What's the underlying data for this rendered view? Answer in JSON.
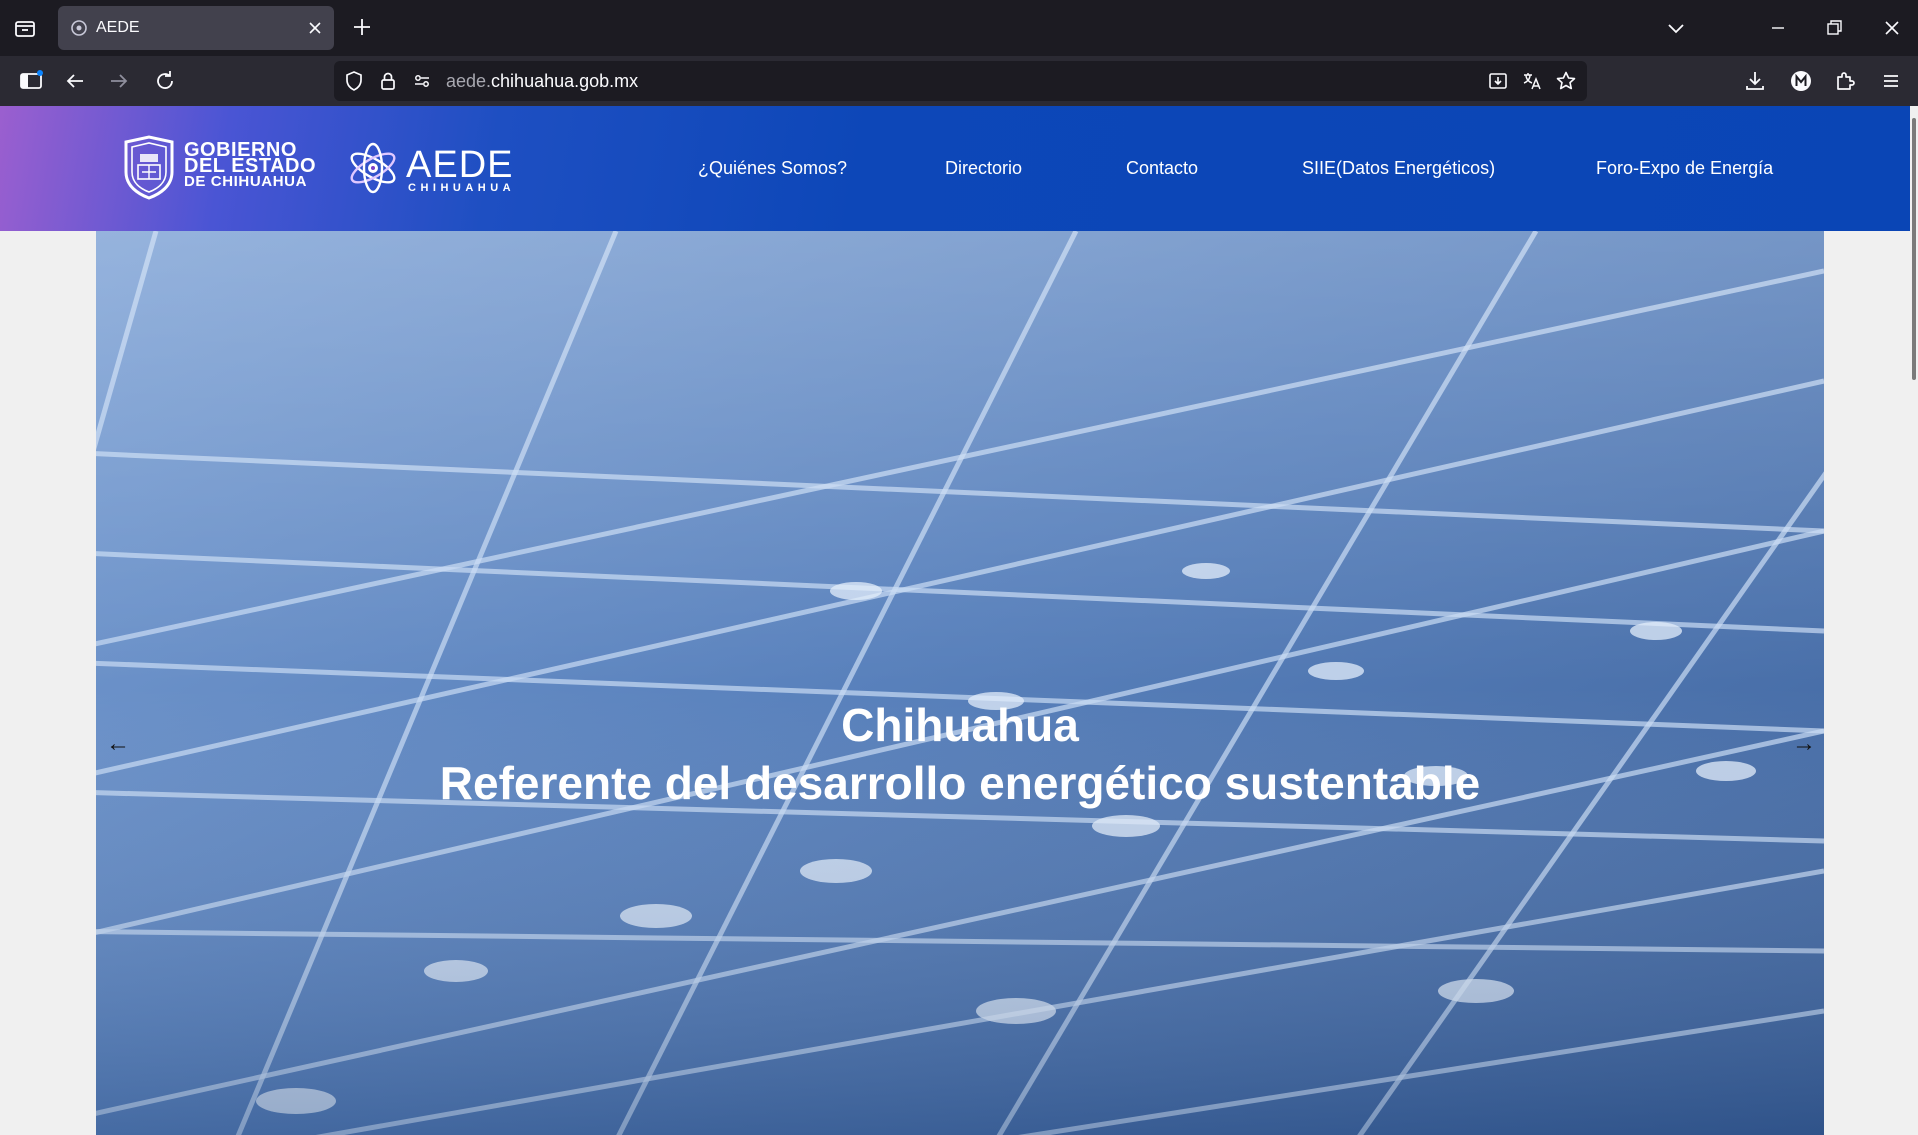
{
  "browser": {
    "tab_title": "AEDE",
    "url_domain_prefix": "aede.",
    "url_domain_main": "chihuahua.gob.mx"
  },
  "site": {
    "gov_logo": {
      "line1": "GOBIERNO",
      "line2": "DEL ESTADO",
      "line3": "DE CHIHUAHUA"
    },
    "aede_logo": {
      "word": "AEDE",
      "sub": "CHIHUAHUA"
    },
    "nav": [
      {
        "label": "¿Quiénes Somos?"
      },
      {
        "label": "Directorio"
      },
      {
        "label": "Contacto"
      },
      {
        "label": "SIIE(Datos Energéticos)"
      },
      {
        "label": "Foro-Expo de Energía"
      }
    ]
  },
  "hero": {
    "title": "Chihuahua",
    "subtitle": "Referente del desarrollo energético sustentable",
    "prev_arrow": "←",
    "next_arrow": "→"
  },
  "colors": {
    "header_gradient_start": "#9b5fcf",
    "header_main": "#0a45b5",
    "hero_panel": "#5f87c2"
  }
}
